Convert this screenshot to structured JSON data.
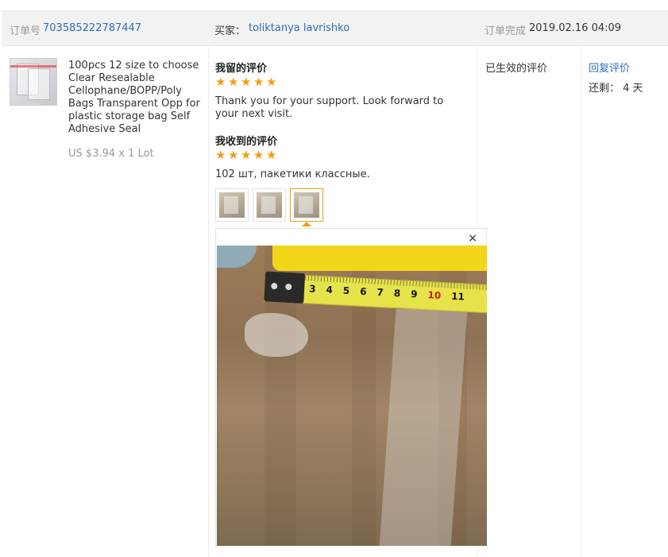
{
  "header": {
    "order_label": "订单号",
    "order_number": "703585222787447",
    "buyer_label": "买家：",
    "buyer_name": "toliktanya lavrishko",
    "completed_label": "订单完成",
    "completed_time": "2019.02.16 04:09"
  },
  "product": {
    "title": "100pcs 12 size to choose Clear Resealable Cellophane/BOPP/Poly Bags Transparent Opp for plastic storage bag Self Adhesive Seal",
    "price": "US $3.94 x 1 Lot"
  },
  "my_review": {
    "heading": "我留的评价",
    "rating": 5,
    "text": "Thank you for your support. Look forward to your next visit."
  },
  "received_review": {
    "heading": "我收到的评价",
    "rating": 5,
    "text": "102 шт, пакетики классные.",
    "photo_count": 3,
    "active_photo": 3
  },
  "popup": {
    "close_symbol": "×",
    "tape_numbers": [
      "3",
      "4",
      "5",
      "6",
      "7",
      "8",
      "9",
      "10",
      "11"
    ]
  },
  "status": {
    "label": "已生效的评价"
  },
  "actions": {
    "reply_label": "回复评价",
    "remaining": "还剩： 4 天"
  },
  "colors": {
    "link": "#2e6db3",
    "star": "#f39c12",
    "header_bg": "#f2f2f2"
  }
}
